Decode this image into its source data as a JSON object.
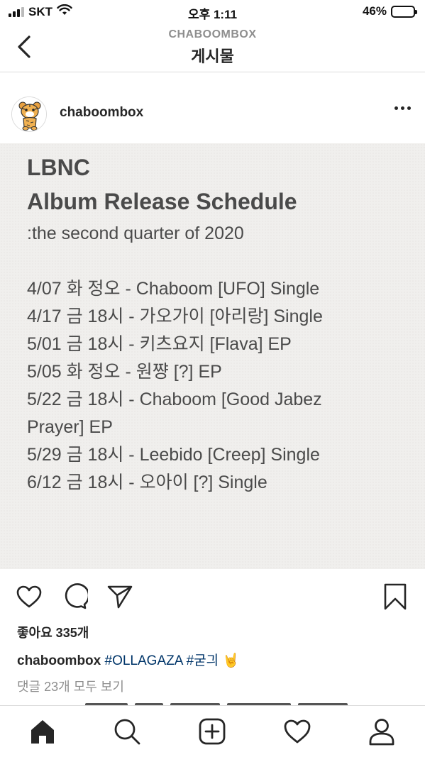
{
  "status_bar": {
    "carrier": "SKT",
    "time": "오후 1:11",
    "battery_percent": "46%",
    "battery_level": 0.46
  },
  "nav": {
    "subtitle": "CHABOOMBOX",
    "title": "게시물",
    "back_icon": "chevron-left-icon"
  },
  "post": {
    "username": "chaboombox",
    "more_icon": "more-horizontal-icon",
    "image": {
      "title_line1": "LBNC",
      "title_line2": "Album Release Schedule",
      "subtitle": ":the second quarter of 2020",
      "schedule": [
        "4/07 화 정오 - Chaboom [UFO] Single",
        "4/17 금 18시 - 가오가이 [아리랑] Single",
        "5/01 금 18시 - 키츠요지 [Flava] EP",
        "5/05 화 정오 - 원쨩 [?] EP",
        "5/22 금 18시 - Chaboom [Good Jabez Prayer] EP",
        "5/29 금 18시 - Leebido [Creep] Single",
        "6/12 금 18시 - 오아이 [?] Single"
      ]
    },
    "likes_text": "좋아요 335개",
    "caption": {
      "username": "chaboombox",
      "tags": "#OLLAGAZA #굳긔",
      "emoji": "🤘"
    },
    "comments_link": "댓글 23개 모두 보기"
  },
  "tab_bar": {
    "items": [
      "home-icon",
      "search-icon",
      "new-post-icon",
      "activity-icon",
      "profile-icon"
    ]
  },
  "colors": {
    "text": "#262626",
    "muted": "#8e8e8e",
    "hashtag": "#003569",
    "divider": "#dbdbdb",
    "image_bg": "#f0efed"
  }
}
